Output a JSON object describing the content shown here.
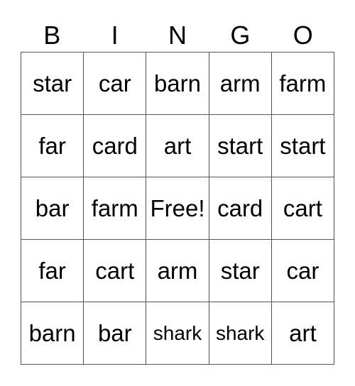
{
  "header": [
    "B",
    "I",
    "N",
    "G",
    "O"
  ],
  "rows": [
    [
      "star",
      "car",
      "barn",
      "arm",
      "farm"
    ],
    [
      "far",
      "card",
      "art",
      "start",
      "start"
    ],
    [
      "bar",
      "farm",
      "Free!",
      "card",
      "cart"
    ],
    [
      "far",
      "cart",
      "arm",
      "star",
      "car"
    ],
    [
      "barn",
      "bar",
      "shark",
      "shark",
      "art"
    ]
  ]
}
